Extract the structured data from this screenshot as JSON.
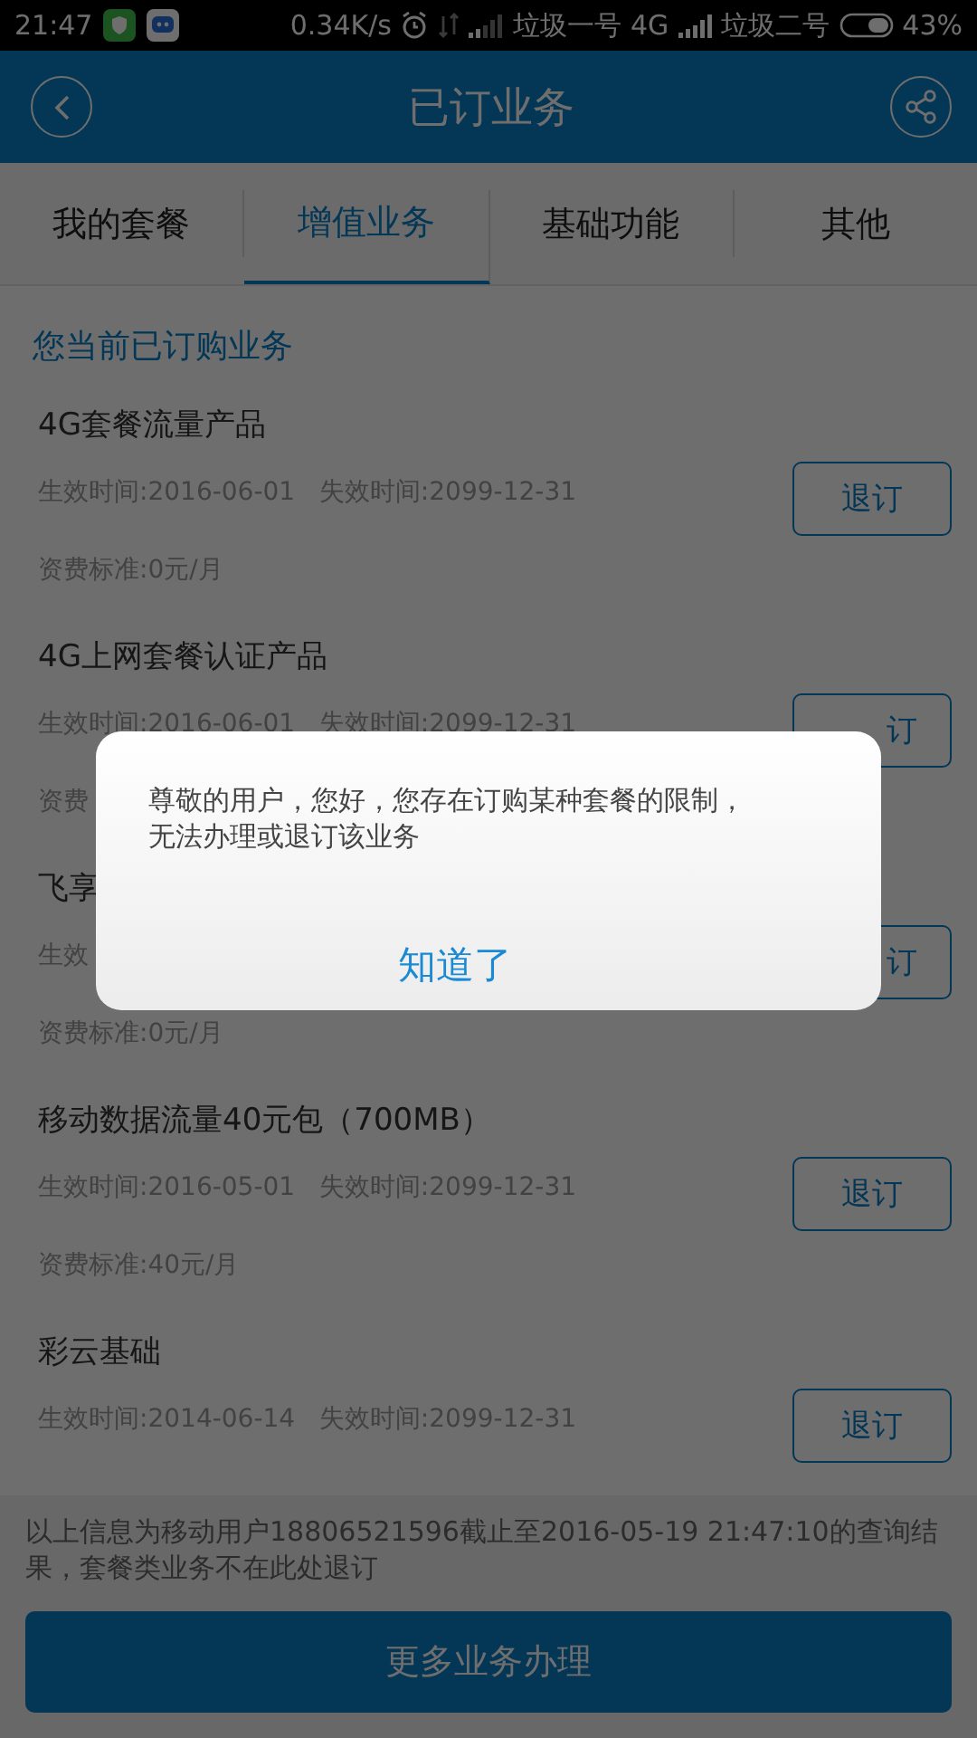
{
  "status_bar": {
    "time": "21:47",
    "speed": "0.34K/s",
    "carrier_1": "垃圾一号",
    "network": "4G",
    "carrier_2": "垃圾二号",
    "battery": "43%"
  },
  "header": {
    "title": "已订业务"
  },
  "tabs": [
    {
      "label": "我的套餐",
      "selected": false
    },
    {
      "label": "增值业务",
      "selected": true
    },
    {
      "label": "基础功能",
      "selected": false
    },
    {
      "label": "其他",
      "selected": false
    }
  ],
  "section_title": "您当前已订购业务",
  "services": [
    {
      "name": "4G套餐流量产品",
      "dates": "生效时间:2016-06-01   失效时间:2099-12-31",
      "fee": "资费标准:0元/月",
      "button": "退订"
    },
    {
      "name": "4G上网套餐认证产品",
      "dates": "生效时间:2016-06-01   失效时间:2099-12-31",
      "fee": "资费",
      "button": "订"
    },
    {
      "name": "飞享",
      "dates": "生效",
      "fee": "资费标准:0元/月",
      "button": "订"
    },
    {
      "name": "移动数据流量40元包（700MB）",
      "dates": "生效时间:2016-05-01   失效时间:2099-12-31",
      "fee": "资费标准:40元/月",
      "button": "退订"
    },
    {
      "name": "彩云基础",
      "dates": "生效时间:2014-06-14   失效时间:2099-12-31",
      "button": "退订"
    }
  ],
  "footer": {
    "note": "以上信息为移动用户18806521596截止至2016-05-19 21:47:10的查询结果，套餐类业务不在此处退订",
    "button": "更多业务办理"
  },
  "dialog": {
    "message": "尊敬的用户，您好，您存在订购某种套餐的限制，无法办理或退订该业务",
    "button": "知道了"
  }
}
